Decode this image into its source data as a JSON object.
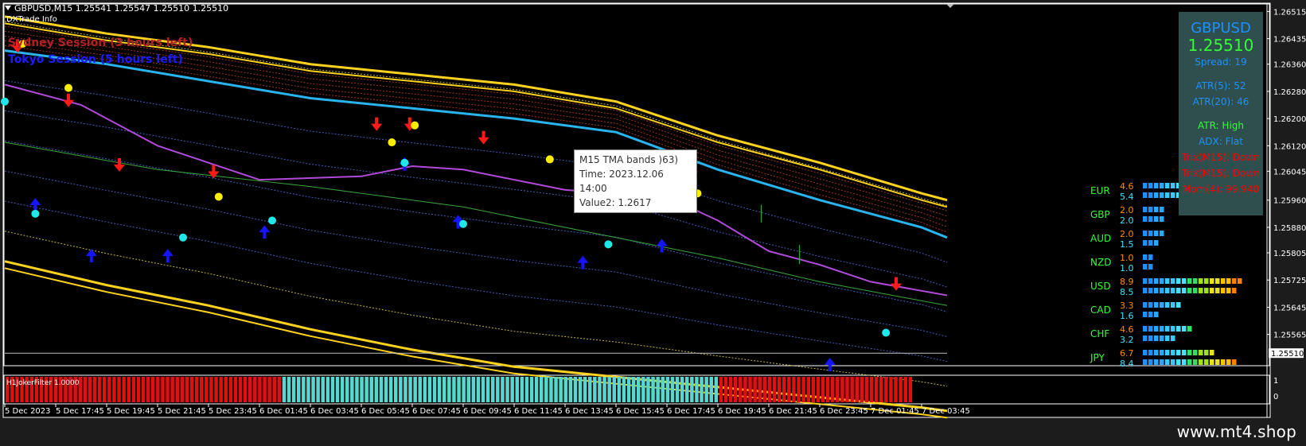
{
  "header": {
    "title": "GBPUSD,M15  1.25541 1.25547 1.25510 1.25510",
    "subtitle": "DXTrade Info"
  },
  "sessions": [
    {
      "label": "Sydney Session (3 hours left)",
      "color": "#b22222"
    },
    {
      "label": "Tokyo Session (5 hours left)",
      "color": "#1c1cff"
    }
  ],
  "tooltip": {
    "line1": "M15 TMA bands )63)",
    "line2": "Time: 2023.12.06 14:00",
    "line3": "Value2: 1.2617"
  },
  "info_panel": {
    "symbol": "GBPUSD",
    "price": "1.25510",
    "spread": "Spread: 19",
    "atr5": "ATR(5): 52",
    "atr20": "ATR(20): 46",
    "atr_state": "ATR: High",
    "adx": "ADX: Flat",
    "trix1": "Trix(M15): Down",
    "trix2": "Trix(M15): Down",
    "mom": "Mom(4): 99.940",
    "colors": {
      "symbol": "#1e90ff",
      "price": "#32ff32",
      "neutral": "#1e90ff",
      "green": "#32ff32",
      "red": "#ff0000"
    }
  },
  "currency_strength": [
    {
      "code": "EUR",
      "v1": "4.6",
      "v2": "5.4"
    },
    {
      "code": "GBP",
      "v1": "2.0",
      "v2": "2.0"
    },
    {
      "code": "AUD",
      "v1": "2.0",
      "v2": "1.5"
    },
    {
      "code": "NZD",
      "v1": "1.0",
      "v2": "1.0"
    },
    {
      "code": "USD",
      "v1": "8.9",
      "v2": "8.5"
    },
    {
      "code": "CAD",
      "v1": "3.3",
      "v2": "1.6"
    },
    {
      "code": "CHF",
      "v1": "4.6",
      "v2": "3.2"
    },
    {
      "code": "JPY",
      "v1": "6.7",
      "v2": "8.4"
    }
  ],
  "subwindow": {
    "label": "H1JokerFilter 1.0000",
    "scale": [
      "1",
      "0"
    ],
    "segments": [
      {
        "state": "down",
        "count": 57,
        "color": "#e01010"
      },
      {
        "state": "up",
        "count": 90,
        "color": "#56d8d0"
      },
      {
        "state": "down",
        "count": 40,
        "color": "#e01010"
      }
    ]
  },
  "footer": {
    "brand": "www.mt4.shop"
  },
  "chart_data": {
    "type": "line",
    "symbol": "GBPUSD",
    "timeframe": "M15",
    "ylim": [
      1.2548,
      1.2653
    ],
    "y_ticks": [
      "1.26515",
      "1.26435",
      "1.26360",
      "1.26280",
      "1.26200",
      "1.26120",
      "1.26045",
      "1.25960",
      "1.25880",
      "1.25805",
      "1.25725",
      "1.25645",
      "1.25565"
    ],
    "current_price_label": "1.25510",
    "x_ticks": [
      "5 Dec 2023",
      "5 Dec 17:45",
      "5 Dec 19:45",
      "5 Dec 21:45",
      "5 Dec 23:45",
      "6 Dec 01:45",
      "6 Dec 03:45",
      "6 Dec 05:45",
      "6 Dec 07:45",
      "6 Dec 09:45",
      "6 Dec 11:45",
      "6 Dec 13:45",
      "6 Dec 15:45",
      "6 Dec 17:45",
      "6 Dec 19:45",
      "6 Dec 21:45",
      "6 Dec 23:45",
      "7 Dec 01:45",
      "7 Dec 03:45"
    ],
    "x_range": [
      0,
      18.5
    ],
    "series": [
      {
        "kind": "tma_center",
        "color": "#2ab4ee",
        "points": [
          [
            0,
            1.264
          ],
          [
            2,
            1.2636
          ],
          [
            4,
            1.2631
          ],
          [
            6,
            1.2626
          ],
          [
            8,
            1.2623
          ],
          [
            10,
            1.262
          ],
          [
            12,
            1.2616
          ],
          [
            14,
            1.2605
          ],
          [
            16,
            1.2596
          ],
          [
            18,
            1.2588
          ],
          [
            18.5,
            1.2585
          ]
        ]
      },
      {
        "kind": "upper_band",
        "color": "#ffd21e",
        "points": [
          [
            0,
            1.265
          ],
          [
            2,
            1.2645
          ],
          [
            4,
            1.2641
          ],
          [
            6,
            1.2636
          ],
          [
            8,
            1.2633
          ],
          [
            10,
            1.263
          ],
          [
            12,
            1.2625
          ],
          [
            14,
            1.2615
          ],
          [
            16,
            1.2607
          ],
          [
            18,
            1.2598
          ],
          [
            18.5,
            1.2596
          ]
        ]
      },
      {
        "kind": "upper_band2",
        "color": "#ffd21e",
        "points": [
          [
            0,
            1.2648
          ],
          [
            2,
            1.2643
          ],
          [
            4,
            1.2639
          ],
          [
            6,
            1.2634
          ],
          [
            8,
            1.2631
          ],
          [
            10,
            1.2628
          ],
          [
            12,
            1.2623
          ],
          [
            14,
            1.2613
          ],
          [
            16,
            1.2605
          ],
          [
            18,
            1.2596
          ],
          [
            18.5,
            1.2594
          ]
        ]
      },
      {
        "kind": "lower_band",
        "color": "#ffd21e",
        "points": [
          [
            0,
            1.2578
          ],
          [
            2,
            1.2571
          ],
          [
            4,
            1.2565
          ],
          [
            6,
            1.2558
          ],
          [
            8,
            1.2552
          ],
          [
            10,
            1.2547
          ],
          [
            12,
            1.2544
          ],
          [
            14,
            1.2541
          ],
          [
            16,
            1.2538
          ],
          [
            18,
            1.2535
          ],
          [
            18.5,
            1.2534
          ]
        ]
      },
      {
        "kind": "lower_band2",
        "color": "#ffd21e",
        "points": [
          [
            0,
            1.2576
          ],
          [
            2,
            1.2569
          ],
          [
            4,
            1.2563
          ],
          [
            6,
            1.2556
          ],
          [
            8,
            1.255
          ],
          [
            10,
            1.2545
          ],
          [
            12,
            1.2542
          ],
          [
            14,
            1.2539
          ],
          [
            16,
            1.2536
          ],
          [
            18,
            1.2533
          ],
          [
            18.5,
            1.2532
          ]
        ]
      },
      {
        "kind": "purple_ma",
        "color": "#b04ad8",
        "points": [
          [
            0,
            1.263
          ],
          [
            1.5,
            1.2624
          ],
          [
            3,
            1.2612
          ],
          [
            5,
            1.2602
          ],
          [
            7,
            1.2603
          ],
          [
            8,
            1.2606
          ],
          [
            9,
            1.2605
          ],
          [
            11,
            1.2599
          ],
          [
            13,
            1.2597
          ],
          [
            14,
            1.259
          ],
          [
            15,
            1.2581
          ],
          [
            16,
            1.2577
          ],
          [
            17,
            1.2572
          ],
          [
            18.5,
            1.2568
          ]
        ]
      },
      {
        "kind": "green_ma",
        "color": "#3ba83b",
        "points": [
          [
            0,
            1.2613
          ],
          [
            3,
            1.2605
          ],
          [
            6,
            1.26
          ],
          [
            9,
            1.2594
          ],
          [
            12,
            1.2585
          ],
          [
            14,
            1.2579
          ],
          [
            16,
            1.2572
          ],
          [
            18.5,
            1.2565
          ]
        ]
      },
      {
        "kind": "current_price",
        "color": "#c0c0c0",
        "points": [
          [
            0,
            1.2551
          ],
          [
            18.5,
            1.2551
          ]
        ]
      }
    ],
    "sell_arrows": [
      [
        0.25,
        1.2641
      ],
      [
        1.25,
        1.2625
      ],
      [
        2.25,
        1.2606
      ],
      [
        4.1,
        1.2604
      ],
      [
        7.3,
        1.2618
      ],
      [
        7.95,
        1.2618
      ],
      [
        9.4,
        1.2614
      ],
      [
        13.5,
        1.2604
      ],
      [
        17.5,
        1.2571
      ]
    ],
    "buy_arrows": [
      [
        0.6,
        1.2595
      ],
      [
        1.7,
        1.258
      ],
      [
        3.2,
        1.258
      ],
      [
        5.1,
        1.2587
      ],
      [
        7.85,
        1.2607
      ],
      [
        8.9,
        1.259
      ],
      [
        11.35,
        1.2578
      ],
      [
        12.9,
        1.2583
      ],
      [
        16.2,
        1.2548
      ]
    ],
    "yellow_dots": [
      [
        0.35,
        1.2642
      ],
      [
        1.25,
        1.2629
      ],
      [
        4.2,
        1.2597
      ],
      [
        7.6,
        1.2613
      ],
      [
        8.05,
        1.2618
      ],
      [
        10.7,
        1.2608
      ],
      [
        13.6,
        1.2598
      ]
    ],
    "cyan_dots": [
      [
        0,
        1.2625
      ],
      [
        0.6,
        1.2592
      ],
      [
        3.5,
        1.2585
      ],
      [
        5.25,
        1.259
      ],
      [
        7.85,
        1.2607
      ],
      [
        9.0,
        1.2589
      ],
      [
        11.85,
        1.2583
      ],
      [
        17.3,
        1.2557
      ]
    ]
  }
}
